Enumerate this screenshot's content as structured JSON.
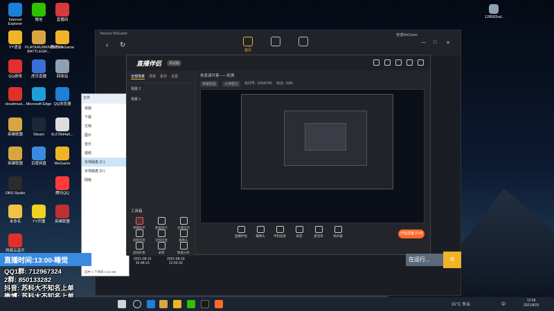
{
  "desktop_icons": [
    {
      "name": "internet-explorer-icon",
      "label": "Internet Explorer",
      "color": "#1e7fd8"
    },
    {
      "name": "wechat-desktop-icon",
      "label": "微信",
      "color": "#2dc100"
    },
    {
      "name": "live-app-icon",
      "label": "直播间",
      "color": "#d63a3a"
    },
    {
      "name": "yy-voice-icon",
      "label": "YY语音",
      "color": "#f0b429"
    },
    {
      "name": "pubg-icon",
      "label": "PLAYERUNKNOWN'S BATTLEGR...",
      "color": "#d8a640"
    },
    {
      "name": "tencent-wegame-icon",
      "label": "腾讯WeGame",
      "color": "#f0b429"
    },
    {
      "name": "qq-icon",
      "label": "QQ游戏",
      "color": "#e03030"
    },
    {
      "name": "huya-icon",
      "label": "虎牙直播",
      "color": "#3a6fd8"
    },
    {
      "name": "recycle-bin-icon",
      "label": "回收站",
      "color": "#8fa0b5"
    },
    {
      "name": "netease-music-icon",
      "label": "cloudmusi...",
      "color": "#e0302a"
    },
    {
      "name": "edge-icon",
      "label": "Microsoft Edge",
      "color": "#1e9fd8"
    },
    {
      "name": "qq-browser-icon",
      "label": "QQ浏览器",
      "color": "#1e7fd8"
    },
    {
      "name": "wegame-icon-2",
      "label": "英雄联盟",
      "color": "#d8a640"
    },
    {
      "name": "steam-icon",
      "label": "Steam",
      "color": "#1b2838"
    },
    {
      "name": "file-icon",
      "label": "6c278d4a0...",
      "color": "#dddddd"
    },
    {
      "name": "lol-icon",
      "label": "英雄联盟",
      "color": "#d8a640"
    },
    {
      "name": "baidu-icon",
      "label": "百度网盘",
      "color": "#3a8ae0"
    },
    {
      "name": "wegame-icon-3",
      "label": "WeGame",
      "color": "#f0b429"
    },
    {
      "name": "obs-icon",
      "label": "OBS Studio",
      "color": "#2b2b2b"
    },
    {
      "name": "qq-music-icon",
      "label": "腾讯QQ",
      "color": "#ff3a3a"
    },
    {
      "name": "folder-icon",
      "label": "未命名",
      "color": "#f2c14a"
    },
    {
      "name": "yy-icon",
      "label": "YY开播",
      "color": "#f0d020"
    },
    {
      "name": "game-icon",
      "label": "英雄联盟",
      "color": "#c03030"
    },
    {
      "name": "netease-cloud-icon",
      "label": "网易云音乐",
      "color": "#e0302a"
    }
  ],
  "tencent_window": {
    "brand": "Tencent WeGame",
    "home_label": "首页",
    "user_label": "管理WeGame"
  },
  "live_window": {
    "logo_text": "直播伴侣",
    "badge": "测试版",
    "tabs": [
      "全部场景",
      "场景",
      "素材",
      "设置"
    ],
    "scenes": [
      "场景 2",
      "场景 1"
    ],
    "title_info": "休息请开麦——轮换",
    "tags": [
      "英雄联盟",
      "大神模式",
      "房间号: 10699785",
      "粉丝: 1686"
    ],
    "tools_title": "工具箱",
    "tools": [
      "弹幕助手",
      "数据统计",
      "主播任务",
      "视频连麦",
      "音频连麦",
      "摄像头",
      "虚拟形象",
      "录像",
      "数据分析",
      "系统设置"
    ],
    "controls": [
      "直播伴侣",
      "摄像头",
      "手机投屏",
      "录音",
      "麦克风",
      "扬声器"
    ],
    "start_button": "开始直播 (Ctrl)"
  },
  "explorer": {
    "title": "文件",
    "side_items": [
      "桌面",
      "下载",
      "文档",
      "图片",
      "音乐",
      "视频",
      "本地磁盘 (C:)",
      "本地磁盘 (D:)",
      "网络"
    ],
    "selected_index": 6,
    "files": [
      {
        "date": "2021-08-15",
        "time": "15-48-15"
      },
      {
        "date": "2021-08-19",
        "time": "12-55-32"
      }
    ],
    "footer": "选中 1 个项目 2.22 GB"
  },
  "overlay": {
    "live_time": "直播时间:13:00-睡觉",
    "lines": [
      "QQ1群: 712967324",
      "2群: 850133282",
      "抖音: 苏科大不知名上单",
      "微博: 苏科大不知名上单",
      "B站: 苏科大不知名上单"
    ]
  },
  "status_box": "在运行...",
  "tray": {
    "weather": "31°C 多云",
    "ime": "中",
    "time": "12:58",
    "date": "2021/8/20"
  },
  "top_right_file": "128583vd..."
}
